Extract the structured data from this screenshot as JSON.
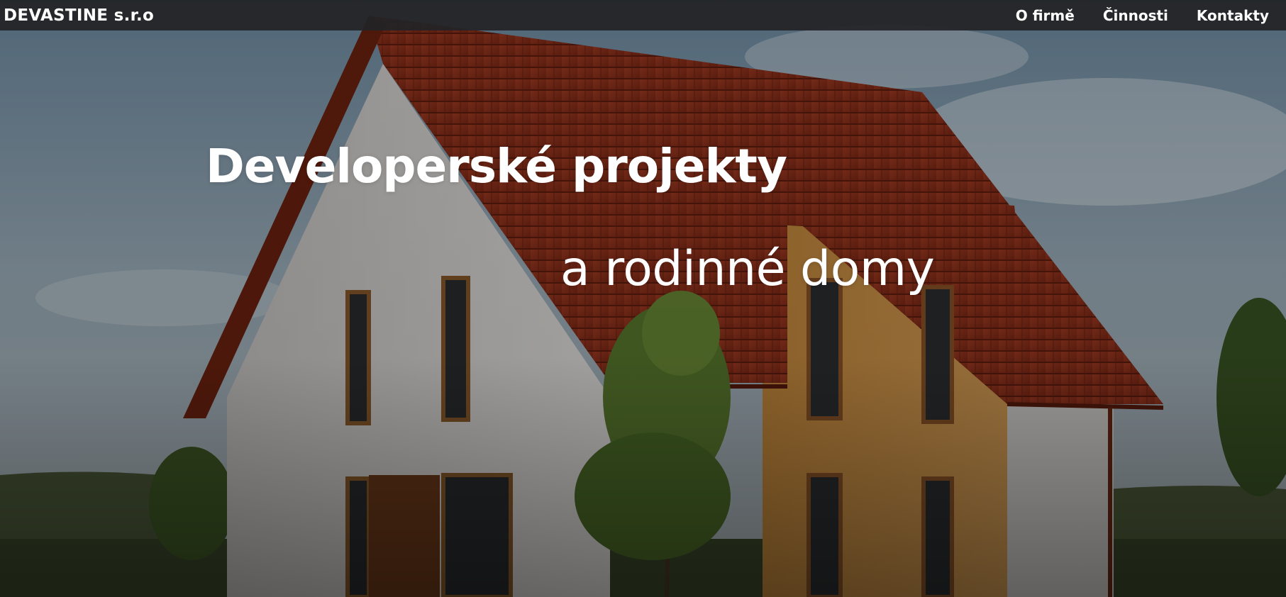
{
  "navbar": {
    "brand": "DEVASTINE s.r.o",
    "links": [
      {
        "label": "O firmě"
      },
      {
        "label": "Činnosti"
      },
      {
        "label": "Kontakty"
      }
    ]
  },
  "hero": {
    "headline_line1": "Developerské projekty",
    "headline_line2": "a rodinné domy"
  },
  "colors": {
    "navbar_bg": "#222426",
    "text": "#ffffff",
    "roof": "#8e2f1c",
    "facade_white": "#dedcd9",
    "facade_ochre": "#c98f45",
    "sky": "#8da3b4"
  }
}
